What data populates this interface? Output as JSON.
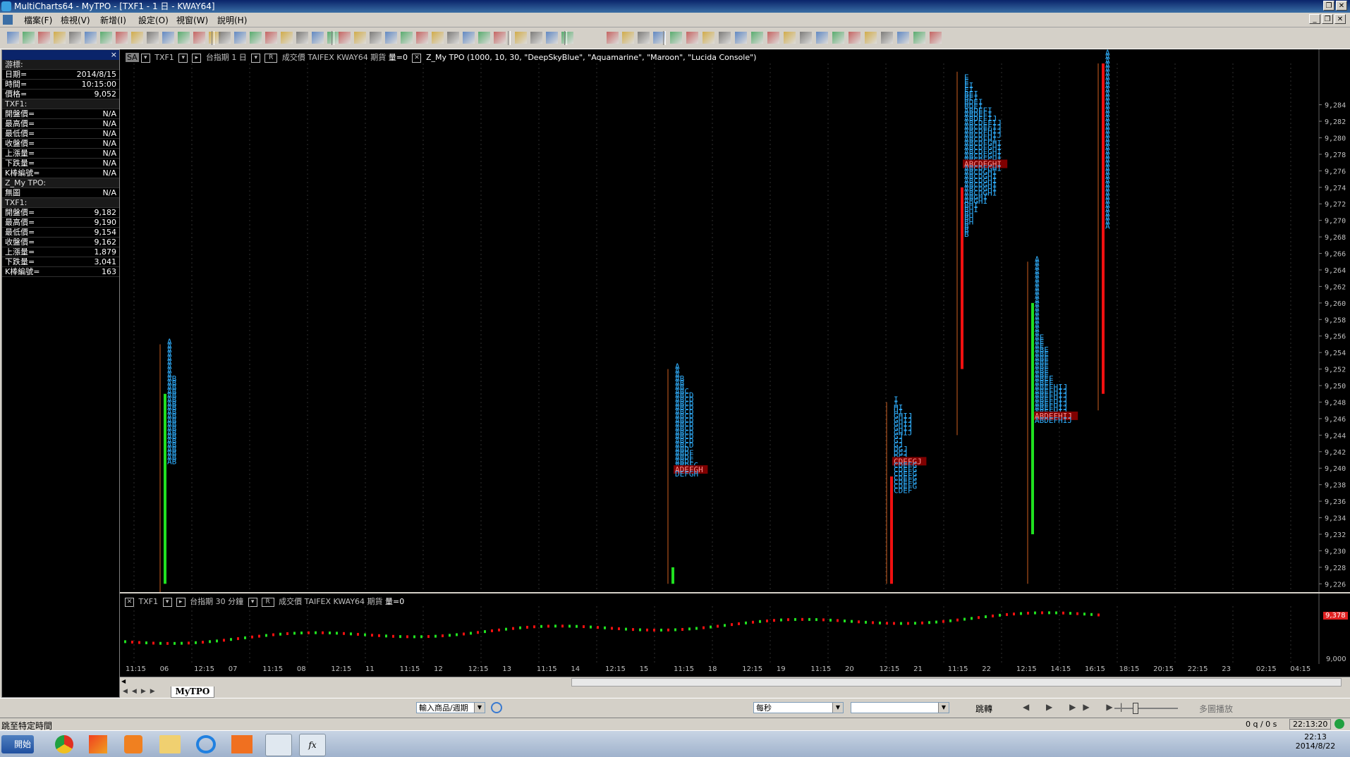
{
  "title": "MultiCharts64 - MyTPO - [TXF1 - 1 日 - KWAY64]",
  "menu": [
    "檔案(F)",
    "檢視(V)",
    "新增(I)",
    "設定(O)",
    "視窗(W)",
    "說明(H)"
  ],
  "data_window": {
    "header": "游標:",
    "rows": [
      {
        "label": "游標:",
        "value": "",
        "section": true
      },
      {
        "label": "日期=",
        "value": "2014/8/15"
      },
      {
        "label": "時間=",
        "value": "10:15:00"
      },
      {
        "label": "價格=",
        "value": "9,052"
      },
      {
        "label": "TXF1:",
        "value": "",
        "section": true
      },
      {
        "label": "開盤價=",
        "value": "N/A"
      },
      {
        "label": "最高價=",
        "value": "N/A"
      },
      {
        "label": "最低價=",
        "value": "N/A"
      },
      {
        "label": "收盤價=",
        "value": "N/A"
      },
      {
        "label": "上漲量=",
        "value": "N/A"
      },
      {
        "label": "下跌量=",
        "value": "N/A"
      },
      {
        "label": "K棒編號=",
        "value": "N/A"
      },
      {
        "label": "Z_My TPO:",
        "value": "",
        "section": true
      },
      {
        "label": "無圖",
        "value": "N/A"
      },
      {
        "label": "TXF1:",
        "value": "",
        "section": true
      },
      {
        "label": "開盤價=",
        "value": "9,182"
      },
      {
        "label": "最高價=",
        "value": "9,190"
      },
      {
        "label": "最低價=",
        "value": "9,154"
      },
      {
        "label": "收盤價=",
        "value": "9,162"
      },
      {
        "label": "上漲量=",
        "value": "1,879"
      },
      {
        "label": "下跌量=",
        "value": "3,041"
      },
      {
        "label": "K棒編號=",
        "value": "163"
      }
    ]
  },
  "main_chart": {
    "header": {
      "badge": "SA",
      "symbol": "TXF1",
      "name": "台指期",
      "interval": "1 日",
      "field": "成交價",
      "exchange": "TAIFEX",
      "feed": "KWAY64",
      "type": "期貨",
      "volume": "量=0",
      "study": "Z_My TPO (1000, 10, 30, \"DeepSkyBlue\", \"Aquamarine\", \"Maroon\", \"Lucida Console\")"
    }
  },
  "sub_chart": {
    "header": {
      "symbol": "TXF1",
      "name": "台指期",
      "interval": "30 分鐘",
      "field": "成交價",
      "exchange": "TAIFEX",
      "feed": "KWAY64",
      "type": "期貨",
      "volume": "量=0"
    },
    "price_tag": "9,378",
    "axis_label": "9,000"
  },
  "time_axis": [
    "11:15",
    "06",
    "12:15",
    "07",
    "11:15",
    "08",
    "12:15",
    "11",
    "11:15",
    "12",
    "12:15",
    "13",
    "11:15",
    "14",
    "12:15",
    "15",
    "11:15",
    "18",
    "12:15",
    "19",
    "11:15",
    "20",
    "12:15",
    "21",
    "11:15",
    "22",
    "12:15",
    "14:15",
    "16:15",
    "18:15",
    "20:15",
    "22:15",
    "23",
    "02:15",
    "04:15"
  ],
  "chart_data": {
    "type": "tpo",
    "y_ticks": [
      9284,
      9282,
      9280,
      9278,
      9276,
      9274,
      9272,
      9270,
      9268,
      9266,
      9264,
      9262,
      9260,
      9258,
      9256,
      9254,
      9252,
      9250,
      9248,
      9246,
      9244,
      9242,
      9240,
      9238,
      9236,
      9234,
      9232,
      9230,
      9228,
      9226
    ],
    "ylim": [
      9225,
      9289
    ],
    "profiles": [
      {
        "top": 9255,
        "letters": [
          "A",
          "A",
          "A",
          "A",
          "A",
          "A",
          "A",
          "A",
          "A",
          "AB",
          "AB",
          "AB",
          "AB",
          "AB",
          "AB",
          "AB",
          "AB",
          "AB",
          "AB",
          "AB",
          "AB",
          "AB",
          "AB",
          "AB",
          "AB",
          "AB",
          "AB",
          "AB",
          "AB",
          "AB"
        ]
      },
      {
        "top": 9252,
        "letters": [
          "A",
          "A",
          "A",
          "AB",
          "AB",
          "AB",
          "ABC",
          "ABCD",
          "ABCD",
          "ABCD",
          "ABCD",
          "ABCD",
          "ABCD",
          "ABCD",
          "ABCD",
          "ABCD",
          "ABCD",
          "ABCD",
          "ABCD",
          "ABCD",
          "ABD",
          "ABDF",
          "ABDF",
          "ABDF",
          "ABDFG",
          "ADEFGH",
          "DEFGH"
        ],
        "highlight": 25
      },
      {
        "top": 9248,
        "letters": [
          "I",
          "I",
          "HI",
          "HI",
          "GHIJ",
          "GHIJ",
          "GHIJ",
          "GHIJ",
          "GHIJ",
          "GJ",
          "GJ",
          "GJ",
          "DGJ",
          "DGJ",
          "DGJ",
          "CDEFGJ",
          "CDEFG",
          "CDEFG",
          "CDEFG",
          "CDEFG",
          "CDEFG",
          "CDEFG",
          "CDEF"
        ],
        "highlight": 15
      },
      {
        "top": 9287,
        "letters": [
          "E",
          "E",
          "EI",
          "EI",
          "BEI",
          "BEI",
          "BDEI",
          "BDEI",
          "ABDEFI",
          "ABDEFI",
          "ABDEFIJ",
          "ABCDEFIJ",
          "ABCDEFIJ",
          "ABCDFHIJ",
          "ABCDFHIJ",
          "ABCDFHI",
          "ABCDFGHI",
          "ABCDFGHI",
          "ABCDFGHI",
          "ABCDFGHI",
          "ABCDFGHI",
          "ABCDFGHI",
          "ABCDFGHI",
          "ABCDGHI",
          "ABCDGHI",
          "ABCDGHI",
          "ABCDGHI",
          "ABCDGHI",
          "ABCDGHI",
          "ABGHI",
          "ABGHI",
          "BHI",
          "BHI",
          "BH",
          "BH",
          "BH",
          "B",
          "B",
          "B"
        ],
        "highlight": 21
      },
      {
        "top": 9265,
        "letters": [
          "A",
          "A",
          "A",
          "A",
          "A",
          "A",
          "A",
          "A",
          "A",
          "A",
          "A",
          "A",
          "A",
          "A",
          "A",
          "A",
          "A",
          "A",
          "A",
          "AE",
          "AE",
          "AE",
          "ABE",
          "ABE",
          "ABE",
          "ABE",
          "ABE",
          "ABE",
          "ABE",
          "ABEF",
          "ABEF",
          "ABEFHIJ",
          "ABEFHIJ",
          "ABEFHIJ",
          "ABEFHIJ",
          "ABEFHIJ",
          "ABEFHIJ",
          "ABEFHIJ",
          "ABDEFHIJ",
          "ABDEFHIJ"
        ],
        "highlight": 38
      },
      {
        "top": 9290,
        "letters": [
          "A",
          "A",
          "A",
          "A",
          "A",
          "A",
          "A",
          "A",
          "A",
          "A",
          "A",
          "A",
          "A",
          "A",
          "A",
          "A",
          "A",
          "A",
          "A",
          "A",
          "A",
          "A",
          "A",
          "A",
          "A",
          "A",
          "A",
          "A",
          "A",
          "A",
          "A",
          "A",
          "A",
          "A",
          "A",
          "A",
          "A",
          "A",
          "A",
          "A",
          "A",
          "A",
          "A"
        ]
      }
    ],
    "candles": [
      {
        "high": 9255,
        "low": 9225,
        "open": 9249,
        "close": 9226,
        "color": "green"
      },
      {
        "high": 9252,
        "low": 9226,
        "open": 9228,
        "close": 9226,
        "color": "green"
      },
      {
        "high": 9248,
        "low": 9226,
        "open": 9239,
        "close": 9226,
        "color": "red"
      },
      {
        "high": 9288,
        "low": 9244,
        "open": 9274,
        "close": 9252,
        "color": "red"
      },
      {
        "high": 9265,
        "low": 9226,
        "open": 9260,
        "close": 9232,
        "color": "green"
      },
      {
        "high": 9289,
        "low": 9247,
        "open": 9289,
        "close": 9249,
        "color": "red"
      }
    ]
  },
  "bottom": {
    "tab": "MyTPO",
    "combo_symbol": "輸入商品/週期",
    "combo_speed": "每秒",
    "combo_empty": "",
    "jump_label": "跳轉",
    "replay_label": "多圖播放",
    "status_text": "跳至特定時間",
    "status_rate": "0 q / 0 s",
    "status_time": "22:13:20"
  },
  "taskbar": {
    "start": "開始",
    "clock_time": "22:13",
    "clock_date": "2014/8/22"
  }
}
